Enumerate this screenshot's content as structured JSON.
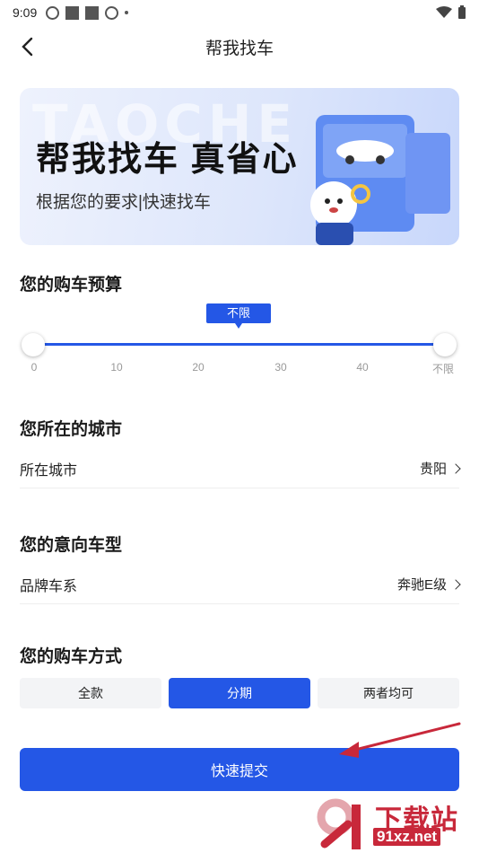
{
  "status_bar": {
    "time": "9:09"
  },
  "nav": {
    "title": "帮我找车"
  },
  "banner": {
    "watermark": "TAOCHE",
    "title": "帮我找车 真省心",
    "subtitle": "根据您的要求|快速找车"
  },
  "budget": {
    "section_title": "您的购车预算",
    "tooltip": "不限",
    "ticks": [
      "0",
      "10",
      "20",
      "30",
      "40",
      "不限"
    ],
    "range_min": "0",
    "range_max": "不限"
  },
  "city": {
    "section_title": "您所在的城市",
    "label": "所在城市",
    "value": "贵阳"
  },
  "car_model": {
    "section_title": "您的意向车型",
    "label": "品牌车系",
    "value": "奔驰E级"
  },
  "purchase": {
    "section_title": "您的购车方式",
    "options": [
      "全款",
      "分期",
      "两者均可"
    ],
    "selected": "分期"
  },
  "submit": {
    "label": "快速提交"
  },
  "colors": {
    "accent": "#2457e6",
    "annotation_arrow": "#c8283a"
  },
  "watermark": {
    "main": "下载站",
    "sub": "91xz.net"
  }
}
